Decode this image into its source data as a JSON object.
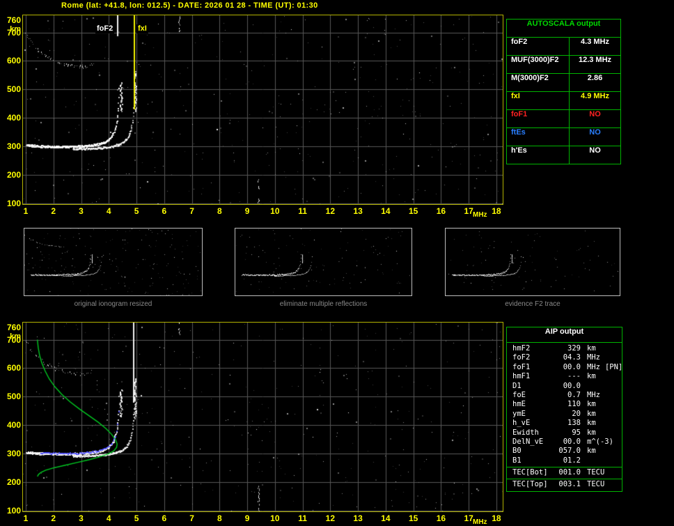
{
  "header": {
    "title": "Rome (lat: +41.8, lon: 012.5) - DATE: 2026 01 28 - TIME (UT): 01:30"
  },
  "colors": {
    "white": "#ffffff",
    "yellow": "#ffff00",
    "red": "#ff2222",
    "blue": "#2a7fff",
    "green": "#00c81e",
    "caption_gray": "#8a8a8a"
  },
  "plots": {
    "y_unit": "km",
    "x_unit": "MHz",
    "y_ticks": [
      760,
      700,
      600,
      500,
      400,
      300,
      200,
      100
    ],
    "x_ticks": [
      1,
      2,
      3,
      4,
      5,
      6,
      7,
      8,
      9,
      10,
      11,
      12,
      13,
      14,
      15,
      16,
      17,
      18
    ]
  },
  "top_plot": {
    "marker_foF2": "foF2",
    "marker_fxI": "fxI"
  },
  "autoscala": {
    "title": "AUTOSCALA output",
    "rows": [
      {
        "label": "foF2",
        "value": "4.3 MHz",
        "color": "white"
      },
      {
        "label": "MUF(3000)F2",
        "value": "12.3 MHz",
        "color": "white"
      },
      {
        "label": "M(3000)F2",
        "value": "2.86",
        "color": "white"
      },
      {
        "label": "fxI",
        "value": "4.9 MHz",
        "color": "yellow"
      },
      {
        "label": "foF1",
        "value": "NO",
        "color": "red"
      },
      {
        "label": "ftEs",
        "value": "NO",
        "color": "blue"
      },
      {
        "label": "h'Es",
        "value": "NO",
        "color": "white"
      }
    ]
  },
  "thumbnails": [
    {
      "caption": "original ionogram resized"
    },
    {
      "caption": "eliminate multiple reflections"
    },
    {
      "caption": "evidence F2 trace"
    }
  ],
  "aip": {
    "title": "AIP output",
    "rows": [
      {
        "label": "hmF2",
        "value": "329",
        "unit": "km",
        "extra": ""
      },
      {
        "label": "foF2",
        "value": "04.3",
        "unit": "MHz",
        "extra": ""
      },
      {
        "label": "foF1",
        "value": "00.0",
        "unit": "MHz",
        "extra": "[PN]"
      },
      {
        "label": "hmF1",
        "value": "---",
        "unit": "km",
        "extra": ""
      },
      {
        "label": "D1",
        "value": "00.0",
        "unit": "",
        "extra": ""
      },
      {
        "label": "foE",
        "value": "0.7",
        "unit": "MHz",
        "extra": ""
      },
      {
        "label": "hmE",
        "value": "110",
        "unit": "km",
        "extra": ""
      },
      {
        "label": "ymE",
        "value": "20",
        "unit": "km",
        "extra": ""
      },
      {
        "label": "h_vE",
        "value": "138",
        "unit": "km",
        "extra": ""
      },
      {
        "label": "Ewidth",
        "value": "95",
        "unit": "km",
        "extra": ""
      },
      {
        "label": "DelN_vE",
        "value": "00.0",
        "unit": "m^(-3)",
        "extra": ""
      },
      {
        "label": "B0",
        "value": "057.0",
        "unit": "km",
        "extra": ""
      },
      {
        "label": "B1",
        "value": "01.2",
        "unit": "",
        "extra": ""
      }
    ],
    "tec_rows": [
      {
        "label": "TEC[Bot]",
        "value": "001.0",
        "unit": "TECU"
      },
      {
        "label": "TEC[Top]",
        "value": "003.1",
        "unit": "TECU"
      }
    ]
  },
  "ionogram": {
    "foF2_MHz": 4.3,
    "fxI_MHz": 4.9,
    "MUF3000F2_MHz": 12.3,
    "M3000F2": 2.86,
    "hmF2_km": 329,
    "trace_base_height_km": 300,
    "trace_top_height_km": 520,
    "freq_range_MHz": [
      1,
      18
    ],
    "height_range_km": [
      100,
      760
    ]
  }
}
